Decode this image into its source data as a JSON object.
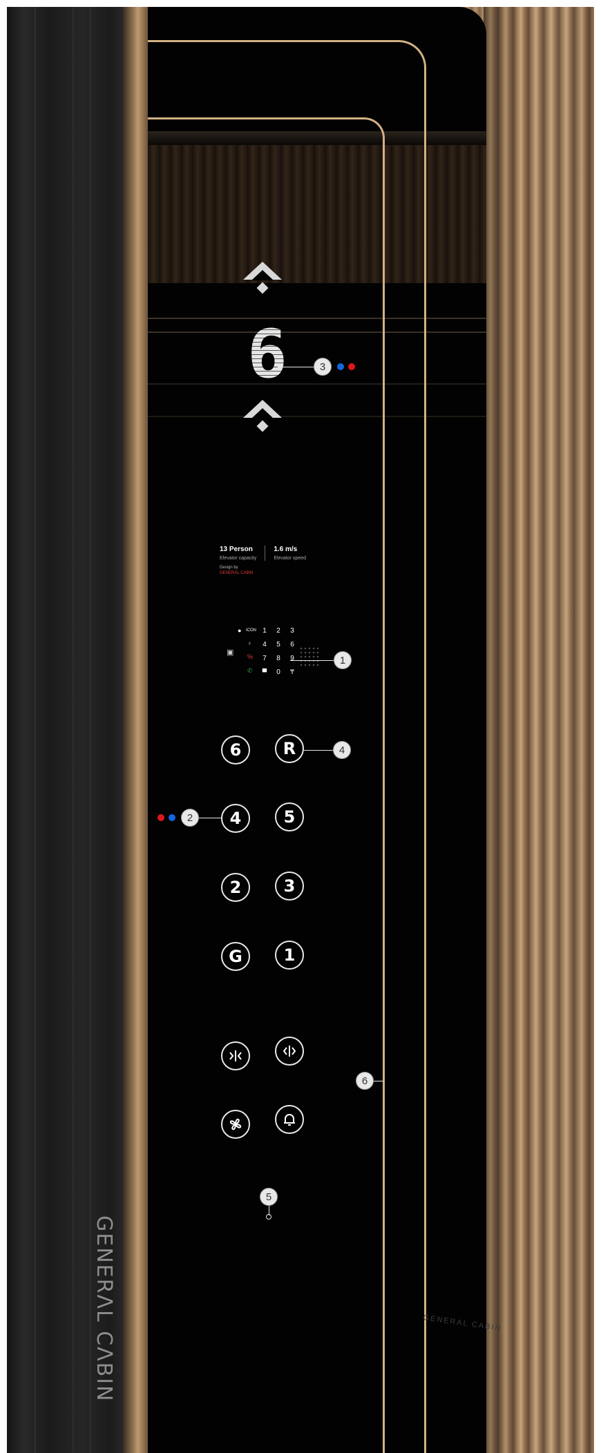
{
  "indicator": {
    "floor": "6",
    "arrow_up_icon": "chevron-up-icon",
    "arrow_down_icon": "chevron-up-icon"
  },
  "info": {
    "capacity_value": "13 Person",
    "capacity_label": "Elevator capacity",
    "speed_value": "1.6 m/s",
    "speed_label": "Elevator speed",
    "brand_line1": "Design by",
    "brand_line2": "GENERAL CABIN"
  },
  "keypad": {
    "keys": [
      "1",
      "2",
      "3",
      "4",
      "5",
      "6",
      "7",
      "8",
      "9",
      "0"
    ],
    "indicator_label": "ICON"
  },
  "buttons": {
    "floor_6": "6",
    "floor_r": "R",
    "floor_4": "4",
    "floor_5": "5",
    "floor_2": "2",
    "floor_3": "3",
    "floor_g": "G",
    "floor_1": "1"
  },
  "callouts": [
    "1",
    "2",
    "3",
    "4",
    "5",
    "6"
  ],
  "logo": "GENERΛL CΛBIN",
  "watermark": "GENERAL CABIN",
  "colors": {
    "gold": "#d2b184",
    "red": "#e0161c",
    "blue": "#1565e0",
    "panel": "#020202"
  }
}
